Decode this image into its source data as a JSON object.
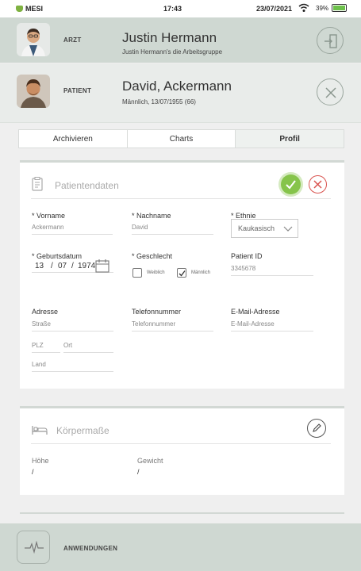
{
  "status_bar": {
    "app": "MESI",
    "time": "17:43",
    "date": "23/07/2021",
    "battery": "39%"
  },
  "doctor": {
    "role": "ARZT",
    "name": "Justin Hermann",
    "group": "Justin Hermann's die Arbeitsgruppe"
  },
  "patient": {
    "role": "PATIENT",
    "name": "David, Ackermann",
    "details": "Männlich, 13/07/1955 (66)"
  },
  "tabs": [
    {
      "label": "Archivieren"
    },
    {
      "label": "Charts"
    },
    {
      "label": "Profil",
      "active": true
    }
  ],
  "patient_data": {
    "title": "Patientendaten",
    "vorname_label": "* Vorname",
    "vorname_value": "Ackermann",
    "nachname_label": "* Nachname",
    "nachname_value": "David",
    "ethnie_label": "* Ethnie",
    "ethnie_value": "Kaukasisch",
    "geburtsdatum_label": "* Geburtsdatum",
    "geburtsdatum_day": "13",
    "geburtsdatum_month": "07",
    "geburtsdatum_year": "1974",
    "date_sep": "/",
    "geschlecht_label": "* Geschlecht",
    "weiblich_label": "Weiblich",
    "maennlich_label": "Männlich",
    "patient_id_label": "Patient ID",
    "patient_id_value": "3345678",
    "adresse_label": "Adresse",
    "strasse_placeholder": "Straße",
    "plz_placeholder": "PLZ",
    "ort_placeholder": "Ort",
    "land_placeholder": "Land",
    "telefon_label": "Telefonnummer",
    "telefon_placeholder": "Telefonnummer",
    "email_label": "E-Mail-Adresse",
    "email_placeholder": "E-Mail-Adresse"
  },
  "body_measures": {
    "title": "Körpermaße",
    "hoehe_label": "Höhe",
    "hoehe_value": "/",
    "gewicht_label": "Gewicht",
    "gewicht_value": "/"
  },
  "bottom_bar": {
    "label": "ANWENDUNGEN"
  },
  "colors": {
    "accent_green": "#86c44b",
    "cancel_red": "#d9534f",
    "band": "#cfd8d2"
  },
  "icons": [
    "wifi-icon",
    "battery-icon",
    "logout-icon",
    "close-icon",
    "clipboard-icon",
    "check-icon",
    "x-icon",
    "calendar-icon",
    "chevron-down-icon",
    "bed-icon",
    "pencil-icon",
    "pulse-icon"
  ]
}
